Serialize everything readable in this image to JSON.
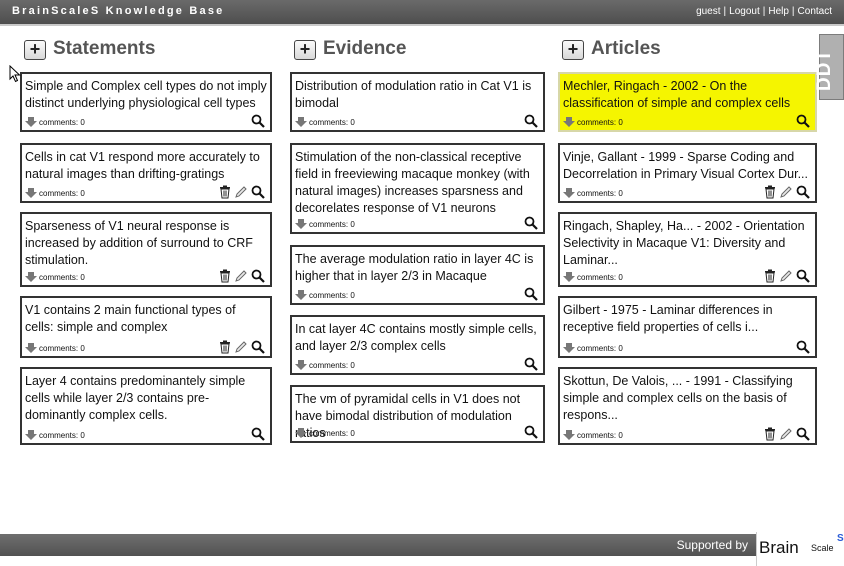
{
  "app": {
    "title": "BrainScaleS Knowledge Base"
  },
  "toplinks": [
    "guest",
    "Logout",
    "Help",
    "Contact"
  ],
  "columns": [
    {
      "title": "Statements",
      "cards": [
        {
          "text": "Simple and Complex cell types do not imply distinct underlying physiological cell types",
          "comments": "comments: 0",
          "actions": [
            "view"
          ]
        },
        {
          "text": "Cells in cat V1 respond more accurately to natural images than drifting-gratings",
          "comments": "comments: 0",
          "actions": [
            "delete",
            "edit",
            "view"
          ]
        },
        {
          "text": "Sparseness of V1 neural response is increased by addition of surround to CRF stimulation.",
          "comments": "comments: 0",
          "actions": [
            "delete",
            "edit",
            "view"
          ]
        },
        {
          "text": "V1 contains 2 main functional types of cells: simple and complex",
          "comments": "comments: 0",
          "actions": [
            "delete",
            "edit",
            "view"
          ]
        },
        {
          "text": "Layer 4 contains predominantely simple cells while layer 2/3 contains pre-dominantly complex cells.",
          "comments": "comments: 0",
          "actions": [
            "view"
          ]
        }
      ]
    },
    {
      "title": "Evidence",
      "cards": [
        {
          "text": "Distribution of modulation ratio in Cat V1 is bimodal",
          "comments": "comments: 0",
          "actions": [
            "view"
          ]
        },
        {
          "text": "Stimulation of the non-classical receptive field in freeviewing macaque monkey (with natural images) increases sparsness and decorelates response of V1 neurons",
          "comments": "comments: 0",
          "actions": [
            "view"
          ]
        },
        {
          "text": "The average modulation ratio in layer 4C is higher that in layer 2/3 in Macaque",
          "comments": "comments: 0",
          "actions": [
            "view"
          ]
        },
        {
          "text": "In cat layer 4C contains mostly simple cells, and layer 2/3 complex cells",
          "comments": "comments: 0",
          "actions": [
            "view"
          ]
        },
        {
          "text": "The vm of pyramidal cells in V1 does not have bimodal distribution of modulation ratios",
          "comments": "comments: 0",
          "actions": [
            "view"
          ]
        }
      ]
    },
    {
      "title": "Articles",
      "cards": [
        {
          "text": "Mechler, Ringach - 2002 - On the classification of simple and complex cells",
          "comments": "comments: 0",
          "actions": [
            "view"
          ],
          "highlighted": true
        },
        {
          "text": "Vinje, Gallant - 1999 - Sparse Coding and Decorrelation in Primary Visual Cortex Dur...",
          "comments": "comments: 0",
          "actions": [
            "delete",
            "edit",
            "view"
          ]
        },
        {
          "text": "Ringach, Shapley, Ha... - 2002 - Orientation Selectivity in Macaque V1: Diversity and Laminar...",
          "comments": "comments: 0",
          "actions": [
            "delete",
            "edit",
            "view"
          ]
        },
        {
          "text": "Gilbert - 1975 - Laminar differences in receptive field properties of cells i...",
          "comments": "comments: 0",
          "actions": [
            "view"
          ]
        },
        {
          "text": "Skottun, De Valois, ... - 1991 - Classifying simple and complex cells on the basis of respons...",
          "comments": "comments: 0",
          "actions": [
            "delete",
            "edit",
            "view"
          ]
        }
      ]
    }
  ],
  "side_tab": {
    "label": "DDT"
  },
  "footer": {
    "supported": "Supported by",
    "logo_text": "BrainScaleS"
  },
  "colors": {
    "topbar": "#555555",
    "highlight": "#f5f500",
    "footer": "#5f5f5f"
  }
}
